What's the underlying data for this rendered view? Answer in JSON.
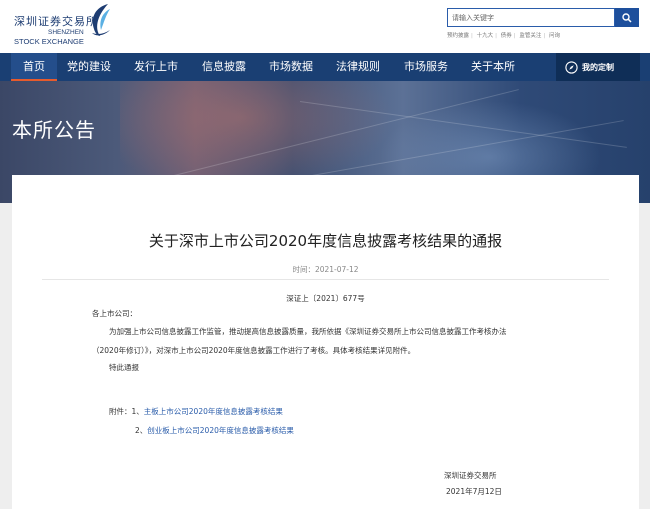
{
  "header": {
    "logo": {
      "cn": "深圳证券交易所",
      "en_line1": "SHENZHEN",
      "en_line2": "STOCK EXCHANGE",
      "mark_color": "#1d3c72",
      "accent_color": "#5bb0e3"
    },
    "search": {
      "placeholder": "请输入关键字",
      "button_icon": "search-icon"
    },
    "hotwords": [
      "预约披露",
      "十九大",
      "债券",
      "监管关注",
      "问询"
    ]
  },
  "nav": {
    "items": [
      "首页",
      "党的建设",
      "发行上市",
      "信息披露",
      "市场数据",
      "法律规则",
      "市场服务",
      "关于本所"
    ],
    "active_index": 0,
    "custom_label": "我的定制",
    "custom_icon": "compass-icon",
    "bg_color": "#1a3f73",
    "active_underline_color": "#e65b2d"
  },
  "banner": {
    "title": "本所公告"
  },
  "article": {
    "title": "关于深市上市公司2020年度信息披露考核结果的通报",
    "date": "时间：2021-07-12",
    "doc_number": "深证上〔2021〕677号",
    "salutation": "各上市公司：",
    "body_line1": "为加强上市公司信息披露工作监管，推动提高信息披露质量，我所依据《深圳证券交易所上市公司信息披露工作考核办法",
    "body_line2": "（2020年修订）》，对深市上市公司2020年度信息披露工作进行了考核。具体考核结果详见附件。",
    "closing": "特此通报",
    "attachments_label": "附件：",
    "attachments": [
      {
        "num": "1、",
        "title": "主板上市公司2020年度信息披露考核结果"
      },
      {
        "num": "2、",
        "title": "创业板上市公司2020年度信息披露考核结果"
      }
    ],
    "signature": "深圳证券交易所",
    "signature_date": "2021年7月12日",
    "link_color": "#2a5caa"
  }
}
